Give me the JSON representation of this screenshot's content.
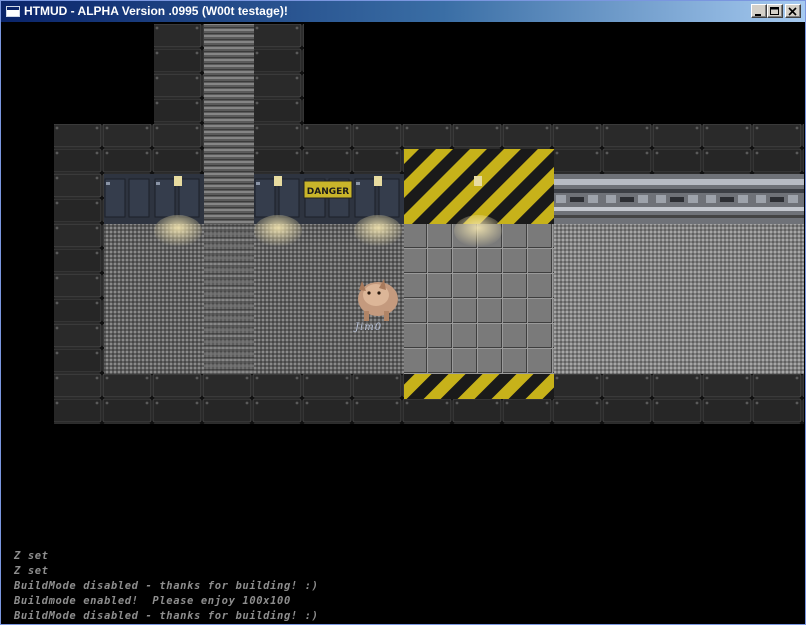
{
  "window": {
    "title": "HTMUD - ALPHA Version .0995 (W00t testage)!",
    "buttons": [
      "minimize",
      "maximize",
      "close"
    ]
  },
  "player": {
    "name": "Jim0"
  },
  "map": {
    "danger_sign": "DANGER"
  },
  "chat": {
    "lines": [
      "Z set",
      "Z set",
      "BuildMode disabled - thanks for building! :)",
      "Buildmode enabled!  Please enjoy 100x100",
      "BuildMode disabled - thanks for building! :)"
    ]
  },
  "colors": {
    "titlebar_start": "#0a246a",
    "titlebar_end": "#a6caf0",
    "hazard_yellow": "#c7b21a",
    "chat_text": "#8e8e8e"
  }
}
